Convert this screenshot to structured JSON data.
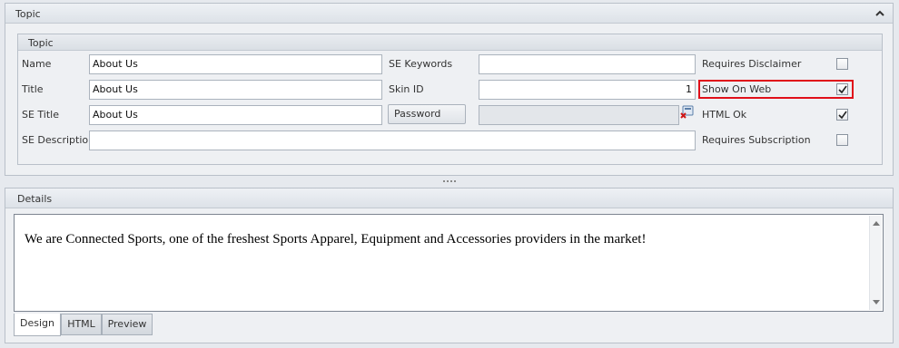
{
  "topic_panel": {
    "header": "Topic",
    "group_header": "Topic",
    "fields": {
      "name": {
        "label": "Name",
        "value": "About Us"
      },
      "title": {
        "label": "Title",
        "value": "About Us"
      },
      "se_title": {
        "label": "SE Title",
        "value": "About Us"
      },
      "se_description": {
        "label": "SE Description",
        "value": ""
      },
      "se_keywords": {
        "label": "SE Keywords",
        "value": ""
      },
      "skin_id": {
        "label": "Skin ID",
        "value": "1"
      },
      "password": {
        "button_label": "Password",
        "value": ""
      }
    },
    "checkboxes": {
      "requires_disclaimer": {
        "label": "Requires Disclaimer",
        "checked": false
      },
      "show_on_web": {
        "label": "Show On Web",
        "checked": true
      },
      "html_ok": {
        "label": "HTML Ok",
        "checked": true
      },
      "requires_subscription": {
        "label": "Requires Subscription",
        "checked": false
      }
    },
    "highlight_color": "#e0101a"
  },
  "details_panel": {
    "header": "Details",
    "content": "We are Connected Sports, one of the freshest Sports Apparel, Equipment and Accessories providers in the market!",
    "tabs": [
      {
        "label": "Design",
        "active": true
      },
      {
        "label": "HTML",
        "active": false
      },
      {
        "label": "Preview",
        "active": false
      }
    ]
  }
}
